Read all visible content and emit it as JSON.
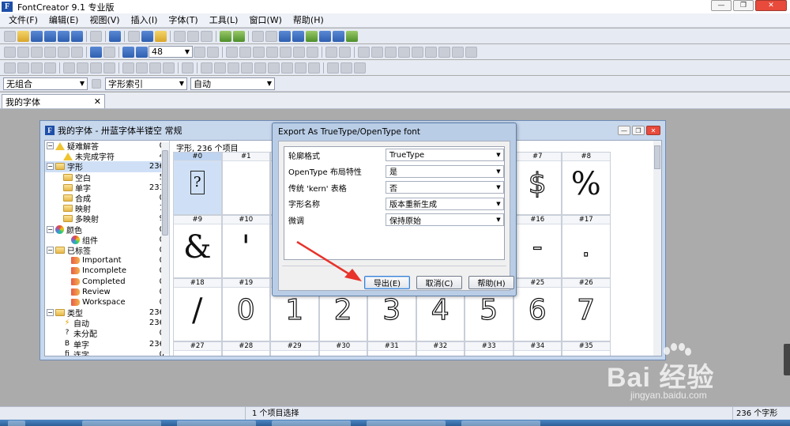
{
  "app": {
    "title": "FontCreator 9.1 专业版"
  },
  "menu": [
    "文件(F)",
    "编辑(E)",
    "视图(V)",
    "插入(I)",
    "字体(T)",
    "工具(L)",
    "窗口(W)",
    "帮助(H)"
  ],
  "toolbar": {
    "zoom_value": "48"
  },
  "dropdowns": {
    "combination": "无组合",
    "glyph_index": "字形索引",
    "auto": "自动"
  },
  "doc_tab": {
    "label": "我的字体"
  },
  "font_window": {
    "title": "我的字体 - 卅蓝字体半镂空 常规",
    "tree": [
      {
        "icon": "warning-icon",
        "label": "疑难解答",
        "count": "0",
        "level": 0
      },
      {
        "icon": "warning-icon",
        "label": "未完成字符",
        "count": "4",
        "level": 1
      },
      {
        "icon": "folder-icon",
        "label": "字形",
        "count": "236",
        "level": 0,
        "selected": true
      },
      {
        "icon": "folder-icon",
        "label": "空白",
        "count": "5",
        "level": 1
      },
      {
        "icon": "folder-icon",
        "label": "单字",
        "count": "231",
        "level": 1
      },
      {
        "icon": "folder-icon",
        "label": "合成",
        "count": "0",
        "level": 1
      },
      {
        "icon": "folder-icon",
        "label": "映射",
        "count": "1",
        "level": 1
      },
      {
        "icon": "folder-icon",
        "label": "多映射",
        "count": "9",
        "level": 1
      },
      {
        "icon": "color-wheel-icon",
        "label": "颜色",
        "count": "0",
        "level": 0
      },
      {
        "icon": "color-wheel-icon",
        "label": "组件",
        "count": "0",
        "level": 2
      },
      {
        "icon": "folder-icon",
        "label": "已标签",
        "count": "0",
        "level": 0
      },
      {
        "icon": "tag-icon",
        "label": "Important",
        "count": "0",
        "level": 2
      },
      {
        "icon": "tag-icon",
        "label": "Incomplete",
        "count": "0",
        "level": 2
      },
      {
        "icon": "tag-icon",
        "label": "Completed",
        "count": "0",
        "level": 2
      },
      {
        "icon": "tag-icon",
        "label": "Review",
        "count": "0",
        "level": 2
      },
      {
        "icon": "tag-icon",
        "label": "Workspace",
        "count": "0",
        "level": 2
      },
      {
        "icon": "folder-icon",
        "label": "类型",
        "count": "236",
        "level": 0
      },
      {
        "icon": "lightning-icon",
        "label": "自动",
        "count": "236",
        "level": 1
      },
      {
        "icon": "question-icon",
        "label": "未分配",
        "count": "0",
        "level": 1
      },
      {
        "icon": "b-glyph-icon",
        "label": "单字",
        "count": "236",
        "level": 1
      },
      {
        "icon": "ligature-icon",
        "label": "连字",
        "count": "0",
        "level": 1
      }
    ],
    "grid_header": "字形, 236 个项目",
    "rows": [
      {
        "labels": [
          "#0",
          "#1",
          "",
          "",
          "",
          "",
          "",
          "#7",
          "#8"
        ],
        "glyphs": [
          "?",
          "",
          "",
          "",
          "",
          "",
          "",
          "$",
          "%"
        ]
      },
      {
        "labels": [
          "#9",
          "#10",
          "",
          "",
          "",
          "",
          "",
          "#16",
          "#17"
        ],
        "glyphs": [
          "&",
          "'",
          "",
          "",
          "",
          "",
          "",
          "-",
          "."
        ]
      },
      {
        "labels": [
          "#18",
          "#19",
          "#20",
          "#21",
          "#22",
          "#23",
          "#24",
          "#25",
          "#26"
        ],
        "glyphs": [
          "/",
          "0",
          "1",
          "2",
          "3",
          "4",
          "5",
          "6",
          "7"
        ]
      },
      {
        "labels": [
          "#27",
          "#28",
          "#29",
          "#30",
          "#31",
          "#32",
          "#33",
          "#34",
          "#35"
        ],
        "glyphs": [
          "",
          "",
          "",
          "",
          "",
          "",
          "",
          "",
          ""
        ]
      }
    ]
  },
  "dialog": {
    "title": "Export As TrueType/OpenType font",
    "properties": [
      {
        "label": "轮廓格式",
        "value": "TrueType"
      },
      {
        "label": "OpenType 布局特性",
        "value": "是"
      },
      {
        "label": "传统 'kern' 表格",
        "value": "否"
      },
      {
        "label": "字形名称",
        "value": "版本重新生成"
      },
      {
        "label": "微调",
        "value": "保持原始"
      }
    ],
    "buttons": {
      "export": "导出(E)",
      "cancel": "取消(C)",
      "help": "帮助(H)"
    }
  },
  "status": {
    "selection": "1 个项目选择",
    "count": "236 个字形"
  },
  "watermark": {
    "logo": "Bai 经验",
    "sub": "jingyan.baidu.com"
  },
  "colors": {
    "accent": "#1e4fa8",
    "selection": "#cfe0f6",
    "arrow": "#e8332a"
  }
}
